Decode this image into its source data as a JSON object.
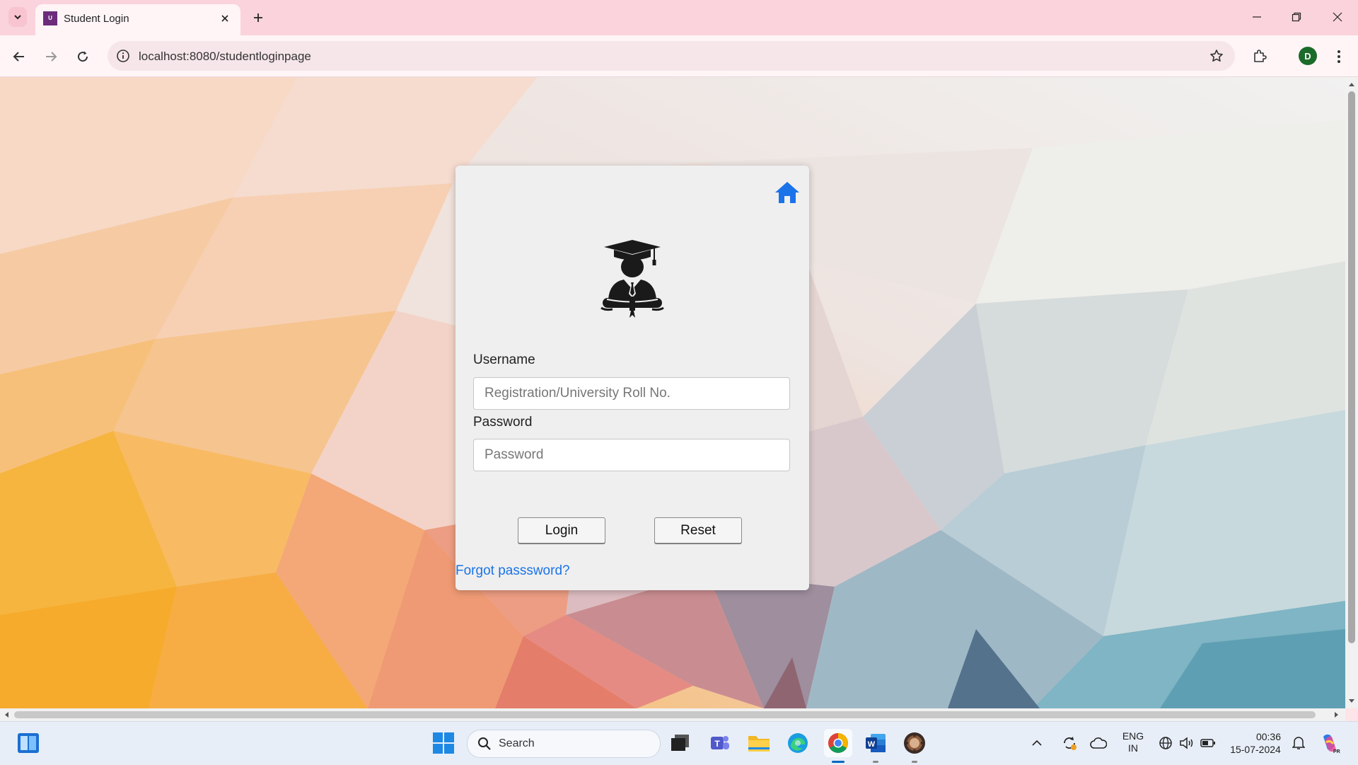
{
  "browser": {
    "tab_title": "Student Login",
    "favicon_text": "U",
    "url": "localhost:8080/studentloginpage",
    "profile_initial": "D"
  },
  "login": {
    "username_label": "Username",
    "username_placeholder": "Registration/University Roll No.",
    "password_label": "Password",
    "password_placeholder": "Password",
    "login_button": "Login",
    "reset_button": "Reset",
    "forgot_link": "Forgot passsword?",
    "accent_color": "#1a73e8"
  },
  "taskbar": {
    "search_placeholder": "Search",
    "language_line1": "ENG",
    "language_line2": "IN",
    "time": "00:36",
    "date": "15-07-2024"
  }
}
